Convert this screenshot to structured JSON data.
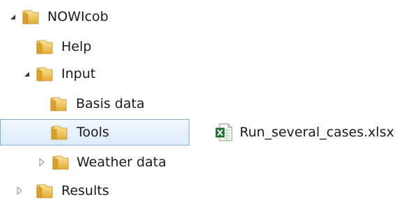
{
  "tree": {
    "items": [
      {
        "label": "NOWIcob",
        "expander": "expanded"
      },
      {
        "label": "Help",
        "expander": "none"
      },
      {
        "label": "Input",
        "expander": "expanded"
      },
      {
        "label": "Basis data",
        "expander": "none"
      },
      {
        "label": "Tools",
        "expander": "none",
        "selected": true
      },
      {
        "label": "Weather data",
        "expander": "collapsed"
      },
      {
        "label": "Results",
        "expander": "collapsed"
      }
    ]
  },
  "file_list": {
    "items": [
      {
        "label": "Run_several_cases.xlsx",
        "icon": "excel-file-icon"
      }
    ]
  },
  "colors": {
    "folder_yellow": "#e8b53a",
    "selection_border": "#84acdd",
    "excel_green": "#1f7a3a"
  }
}
